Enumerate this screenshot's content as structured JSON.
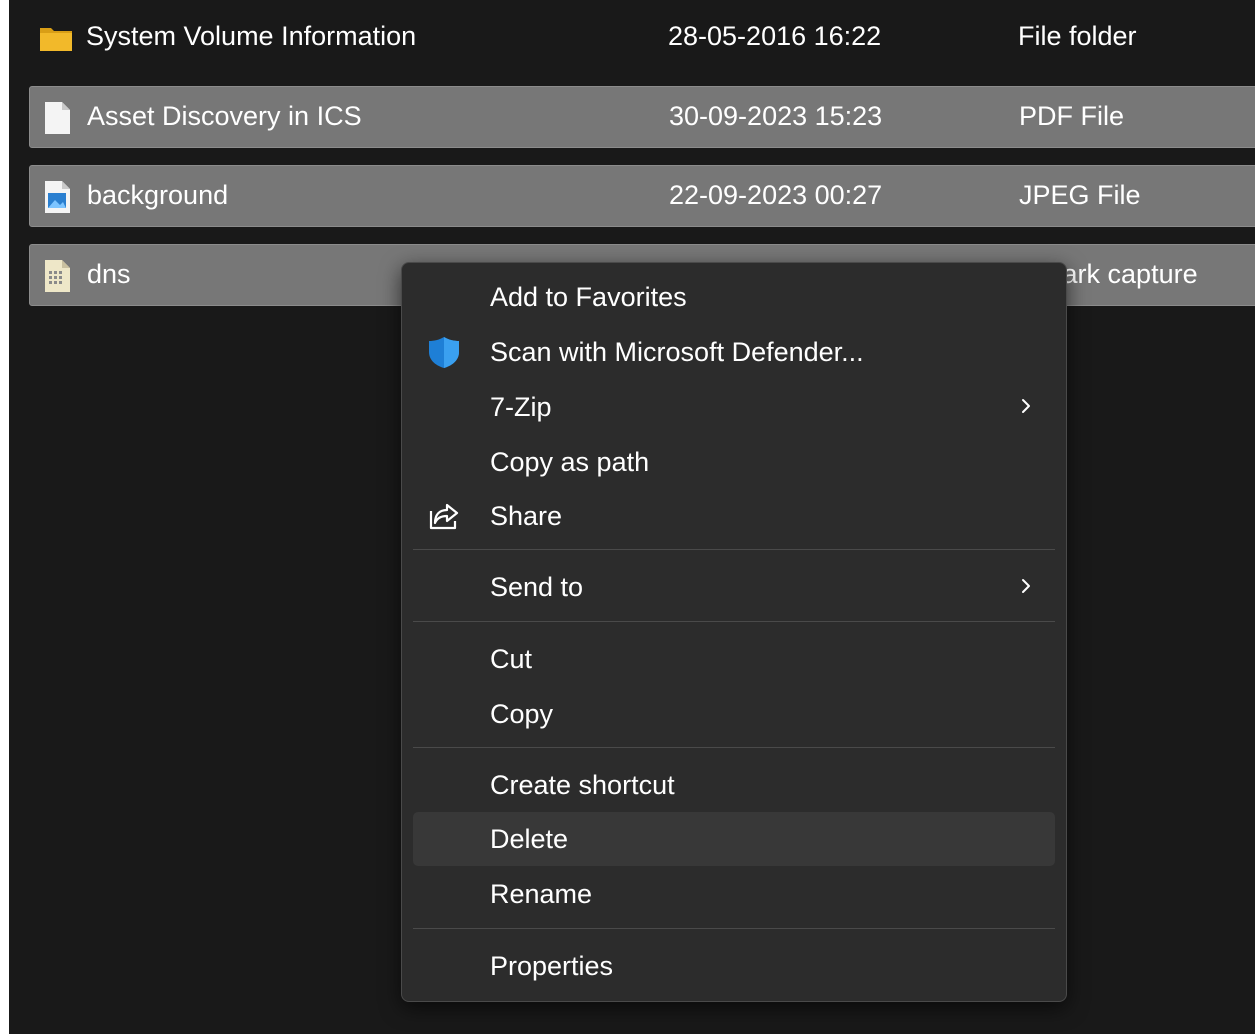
{
  "files": [
    {
      "name": "System Volume Information",
      "date": "28-05-2016 16:22",
      "type": "File folder",
      "icon": "folder-icon",
      "selected": false
    },
    {
      "name": "Asset Discovery in ICS",
      "date": "30-09-2023 15:23",
      "type": "PDF File",
      "icon": "document-icon",
      "selected": true
    },
    {
      "name": "background",
      "date": "22-09-2023 00:27",
      "type": "JPEG File",
      "icon": "image-file-icon",
      "selected": true
    },
    {
      "name": "dns",
      "date": "",
      "type": "eshark capture",
      "icon": "capture-file-icon",
      "selected": true
    }
  ],
  "context_menu": {
    "items": [
      {
        "label": "Add to Favorites"
      },
      {
        "label": "Scan with Microsoft Defender...",
        "icon": "defender-shield-icon"
      },
      {
        "label": "7-Zip",
        "submenu": true
      },
      {
        "label": "Copy as path"
      },
      {
        "label": "Share",
        "icon": "share-icon"
      },
      {
        "label": "Send to",
        "submenu": true
      },
      {
        "label": "Cut"
      },
      {
        "label": "Copy"
      },
      {
        "label": "Create shortcut"
      },
      {
        "label": "Delete",
        "highlighted": true
      },
      {
        "label": "Rename"
      },
      {
        "label": "Properties"
      }
    ]
  },
  "colors": {
    "window_bg": "#191919",
    "selection_bg": "#777777",
    "menu_bg": "#2c2c2c",
    "menu_hover": "#383838",
    "folder_accent": "#f2b92a",
    "defender_blue": "#1e7fd6"
  }
}
